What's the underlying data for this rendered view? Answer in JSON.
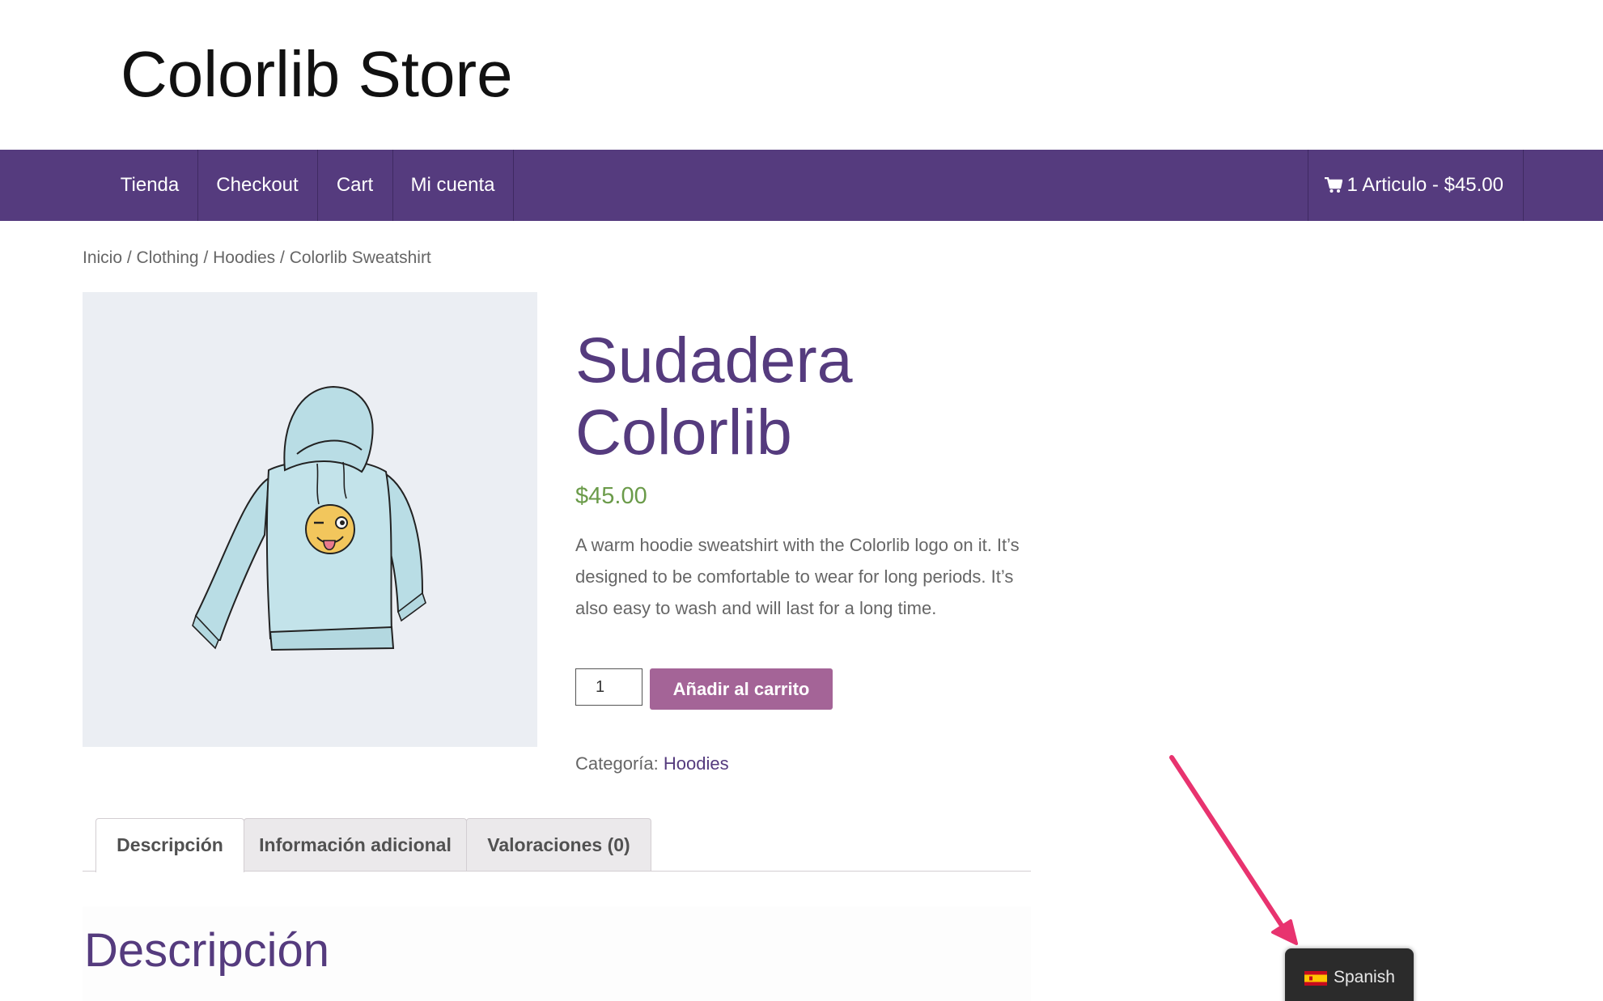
{
  "header": {
    "site_title": "Colorlib Store"
  },
  "nav": {
    "items": [
      {
        "label": "Tienda"
      },
      {
        "label": "Checkout"
      },
      {
        "label": "Cart"
      },
      {
        "label": "Mi cuenta"
      }
    ],
    "cart_summary": "1 Articulo - $45.00",
    "cart_icon": "cart-icon"
  },
  "breadcrumb": {
    "items": [
      "Inicio",
      "Clothing",
      "Hoodies",
      "Colorlib Sweatshirt"
    ],
    "separator": " / "
  },
  "product": {
    "image_alt": "hoodie",
    "title_line1": "Sudadera",
    "title_line2": "Colorlib",
    "price": "$45.00",
    "short_description": "A warm hoodie sweatshirt with the Colorlib logo on it. It’s designed to be comfortable to wear for long periods. It’s also easy to wash and will last for a long time.",
    "quantity": "1",
    "add_to_cart_label": "Añadir al carrito",
    "category_label": "Categoría:",
    "category_value": "Hoodies"
  },
  "tabs": [
    {
      "label": "Descripción",
      "active": true
    },
    {
      "label": "Información adicional",
      "active": false
    },
    {
      "label": "Valoraciones (0)",
      "active": false
    }
  ],
  "description_panel": {
    "heading": "Descripción"
  },
  "language_switcher": {
    "label": "Spanish",
    "flag_icon": "spain-flag-icon"
  },
  "colors": {
    "nav_bg": "#553b7e",
    "accent_purple": "#553b7e",
    "button_bg": "#a46497",
    "price_green": "#6b9b4a",
    "annotation_arrow": "#e8336f"
  }
}
